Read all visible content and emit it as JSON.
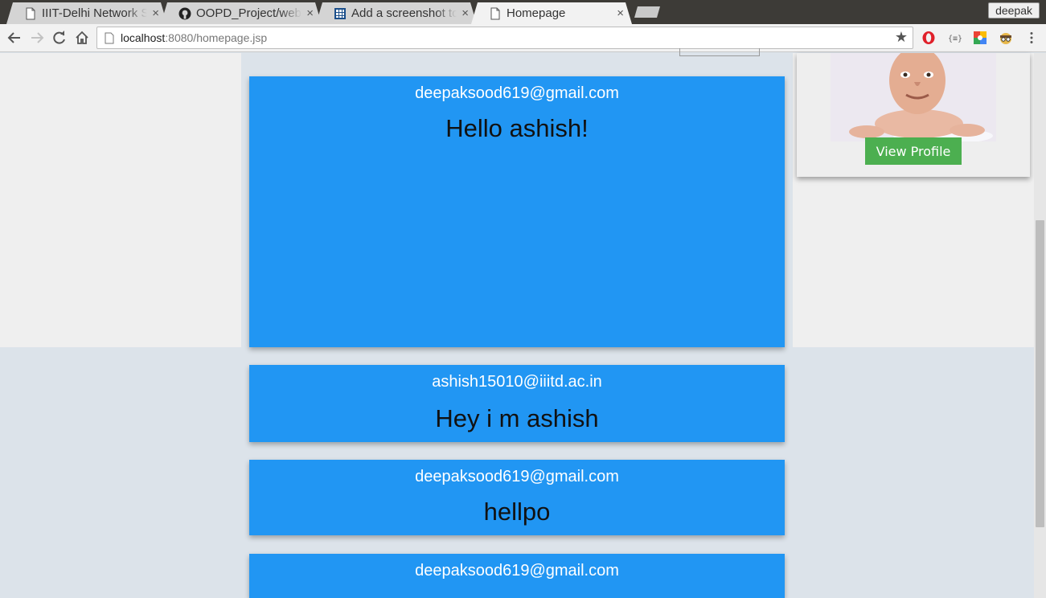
{
  "browser": {
    "tabs": [
      {
        "title": "IIIT-Delhi Network S",
        "icon": "page-icon",
        "close": "×"
      },
      {
        "title": "OOPD_Project/web",
        "icon": "github-icon",
        "close": "×"
      },
      {
        "title": "Add a screenshot to",
        "icon": "grid-icon",
        "close": "×"
      },
      {
        "title": "Homepage",
        "icon": "page-icon",
        "close": "×"
      }
    ],
    "profile_name": "deepak",
    "url_host": "localhost",
    "url_rest": ":8080/homepage.jsp",
    "bookmark_icon": "★"
  },
  "profile_card": {
    "avatar_icon": "avatar-photo",
    "button_label": "View Profile",
    "button_color": "#4caf50"
  },
  "posts": [
    {
      "author": "deepaksood619@gmail.com",
      "message": "Hello ashish!"
    },
    {
      "author": "ashish15010@iiitd.ac.in",
      "message": "Hey i m ashish"
    },
    {
      "author": "deepaksood619@gmail.com",
      "message": "hellpo"
    },
    {
      "author": "deepaksood619@gmail.com",
      "message": ""
    }
  ],
  "colors": {
    "post_bg": "#2196f3",
    "page_bg": "#dce3ea",
    "pane_bg": "#efefef"
  }
}
